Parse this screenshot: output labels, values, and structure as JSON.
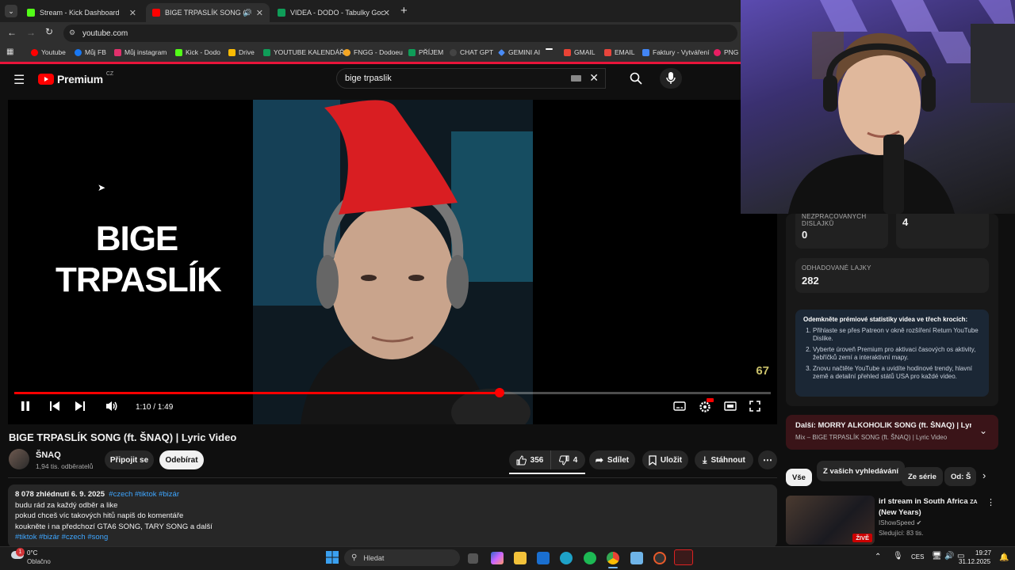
{
  "browser": {
    "tabs": [
      {
        "title": "Stream - Kick Dashboard",
        "color": "#53fc18"
      },
      {
        "title": "BIGE TRPASLÍK SONG (ft. Š",
        "color": "#ff0000"
      },
      {
        "title": "VIDEA - DODO - Tabulky Goog",
        "color": "#0f9d58"
      }
    ],
    "url": "youtube.com",
    "bookmarks": [
      {
        "label": "Youtube",
        "color": "#ff0000"
      },
      {
        "label": "Můj FB",
        "color": "#1877f2"
      },
      {
        "label": "Můj instagram",
        "color": "#e1306c"
      },
      {
        "label": "Kick - Dodo",
        "color": "#53fc18"
      },
      {
        "label": "Drive",
        "color": "#fbbc04"
      },
      {
        "label": "YOUTUBE KALENDÁŘ",
        "color": "#0f9d58"
      },
      {
        "label": "FNGG - Dodoeu",
        "color": "#f5a623"
      },
      {
        "label": "PŘÍJEM",
        "color": "#0f9d58"
      },
      {
        "label": "CHAT GPT",
        "color": "#444444"
      },
      {
        "label": "GEMINI AI",
        "color": "#4a8cf7"
      },
      {
        "label": "",
        "color": "#ffffff"
      },
      {
        "label": "GMAIL",
        "color": "#ea4335"
      },
      {
        "label": "EMAIL",
        "color": "#e8453c"
      },
      {
        "label": "Faktury - Vytváření",
        "color": "#4285f4"
      },
      {
        "label": "PNG",
        "color": "#e91e63"
      }
    ]
  },
  "youtube": {
    "logo_text": "Premium",
    "logo_region": "CZ",
    "search_value": "bige trpaslik"
  },
  "player": {
    "overlay_title_line1": "BIGE",
    "overlay_title_line2": "TRPASLÍK",
    "corner_number": "67",
    "time": "1:10 / 1:49",
    "progress": 0.642
  },
  "video": {
    "title": "BIGE TRPASLÍK SONG (ft. ŠNAQ) | Lyric Video",
    "channel": "ŠNAQ",
    "subscribers": "1,94 tis. odběratelů",
    "join_label": "Připojit se",
    "subscribe_label": "Odebírat",
    "likes": "356",
    "dislikes": "4",
    "share_label": "Sdílet",
    "save_label": "Uložit",
    "download_label": "Stáhnout",
    "views_date": "8 078 zhlédnutí  6. 9. 2025",
    "top_tags": "#czech #tiktok #bizár",
    "desc_lines": [
      "budu rád za každý odběr a like",
      "pokud chceš víc takových hitů napiš do komentáře",
      "koukněte i na předchozí GTA6 SONG, TARY SONG a další"
    ],
    "bottom_tags": "#tiktok #bizár #czech #song"
  },
  "stats": {
    "unprocessed_label": "NEZPRACOVANÝCH DISLAJKŮ",
    "unprocessed_value": "0",
    "dislikes_value": "4",
    "estimated_label": "ODHADOVANÉ LAJKY",
    "estimated_value": "282",
    "promo_title": "Odemkněte prémiové statistiky videa ve třech krocích:",
    "promo_steps": [
      "Přihlaste se přes Patreon v okně rozšíření Return YouTube Dislike.",
      "Vyberte úroveň Premium pro aktivaci časových os aktivity, žebříčků zemí a interaktivní mapy.",
      "Znovu načtěte YouTube a uvidíte hodinové trendy, hlavní země a detailní přehled států USA pro každé video."
    ]
  },
  "up_next": {
    "title": "Další: MORRY ALKOHOLIK SONG (ft. ŠNAQ) | Lyric ...",
    "subtitle": "Mix – BIGE TRPASLÍK SONG (ft. ŠNAQ) | Lyric Video"
  },
  "chips": [
    "Vše",
    "Z vašich vyhledávání",
    "Ze série",
    "Od: Š"
  ],
  "recommended": {
    "title": "irl stream in South Africa",
    "title_extra": "ZA",
    "title_line2": "(New Years)",
    "channel": "IShowSpeed",
    "viewers": "Sledující: 83 tis.",
    "live_badge": "ŽIVĚ"
  },
  "taskbar": {
    "weather_temp": "0°C",
    "weather_desc": "Oblačno",
    "weather_badge": "1",
    "search_placeholder": "Hledat",
    "lang": "CES",
    "time": "19:27",
    "date": "31.12.2025"
  },
  "colors": {
    "accent_red": "#ff0000",
    "stream_red": "#e8143a",
    "tag_blue": "#3ea6ff"
  }
}
